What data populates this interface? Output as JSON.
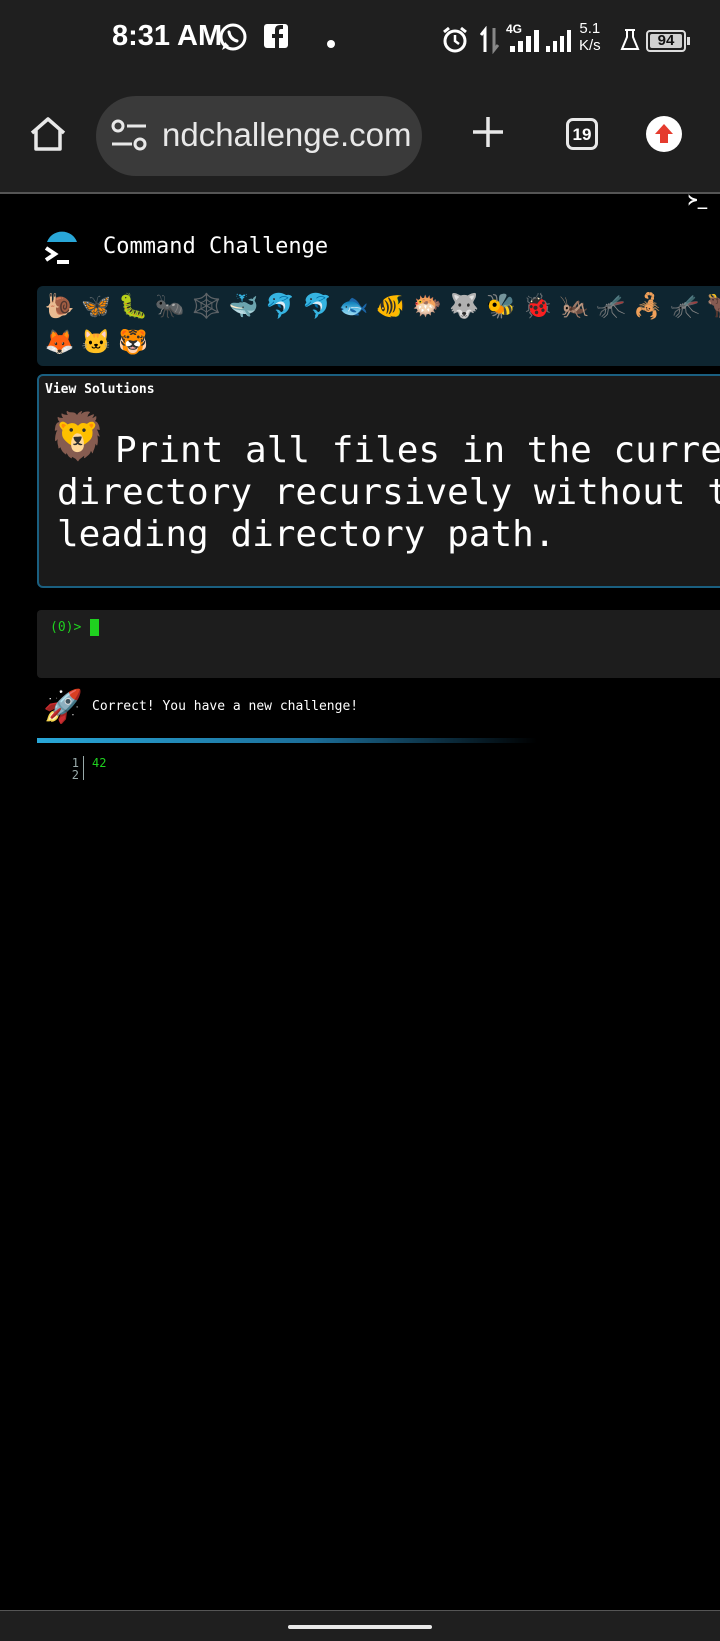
{
  "status_bar": {
    "time": "8:31 AM",
    "network_type": "4G",
    "net_speed": "5.1",
    "net_speed_unit": "K/s",
    "battery": "94",
    "icons": [
      "whatsapp-icon",
      "facebook-icon",
      "dot-icon",
      "alarm-icon",
      "data-arrows-icon",
      "signal-icon",
      "signal-icon",
      "flask-icon",
      "battery-icon"
    ]
  },
  "browser": {
    "url": "ndchallenge.com",
    "tab_count": "19",
    "icons": [
      "home-icon",
      "site-settings-icon",
      "new-tab-icon",
      "tab-switcher-icon",
      "update-icon"
    ]
  },
  "page": {
    "corner_prompt": "≻_",
    "title": "Command Challenge",
    "emoji_row1": [
      "🐌",
      "🦋",
      "🐛",
      "🐜",
      "🕸️",
      "🐳",
      "🐬",
      "🐬",
      "🐟",
      "🐠",
      "🐡",
      "🐺",
      "🐝",
      "🐞",
      "🦗",
      "🦟",
      "🦂",
      "🦟",
      "🐂"
    ],
    "emoji_row2": [
      "🦊",
      "🐱",
      "🐯"
    ],
    "view_solutions": "View Solutions",
    "challenge_emoji": "🦁",
    "challenge_text": "Print all files in the current\ndirectory recursively without the\nleading directory path.",
    "prompt": "(0)>",
    "result_emoji": "🚀",
    "result_text": "Correct! You have a new challenge!",
    "output_lines": [
      {
        "num": "1",
        "text": "42"
      },
      {
        "num": "2",
        "text": ""
      }
    ]
  },
  "colors": {
    "accent": "#29a7d8",
    "terminal_green": "#1fd11f",
    "strip_bg": "#0e2530",
    "box_border": "#1a5f80"
  }
}
